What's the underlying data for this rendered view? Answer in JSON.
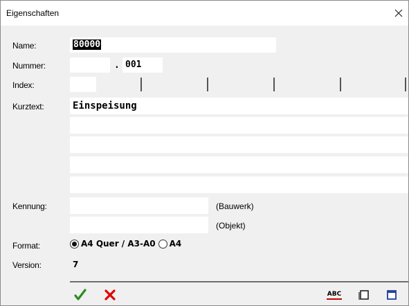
{
  "window": {
    "title": "Eigenschaften"
  },
  "labels": {
    "name": "Name:",
    "nummer": "Nummer:",
    "index": "Index:",
    "kurztext": "Kurztext:",
    "kennung": "Kennung:",
    "format": "Format:",
    "version": "Version:"
  },
  "fields": {
    "name_value": "80000",
    "nummer_prefix": "",
    "nummer_dot": ".",
    "nummer_suffix": "001",
    "index_value": "",
    "kurztext_lines": [
      "Einspeisung",
      "",
      "",
      "",
      ""
    ],
    "kennung_bauwerk": "",
    "kennung_objekt": "",
    "bauwerk_suffix": "(Bauwerk)",
    "objekt_suffix": "(Objekt)"
  },
  "format": {
    "options": [
      "A4 Quer / A3-A0",
      "A4"
    ],
    "selected": "A4 Quer / A3-A0"
  },
  "version_value": "7",
  "toolbar": {
    "ok_icon": "checkmark-icon",
    "cancel_icon": "cross-icon",
    "spellcheck_label": "ABC",
    "copy_icon": "copy-icon",
    "window_icon": "window-icon"
  },
  "colors": {
    "ok": "#2e8b20",
    "cancel": "#e00000",
    "spellcheck_underline": "#cc0000",
    "window_icon": "#1e3a9c"
  }
}
